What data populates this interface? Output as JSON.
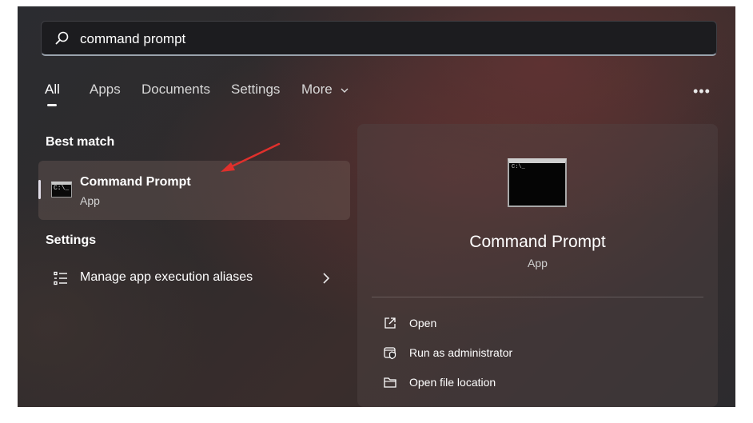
{
  "search": {
    "value": "command prompt"
  },
  "tabs": [
    {
      "label": "All",
      "active": true
    },
    {
      "label": "Apps"
    },
    {
      "label": "Documents"
    },
    {
      "label": "Settings"
    },
    {
      "label": "More"
    }
  ],
  "more_options_label": "•••",
  "best_match": {
    "heading": "Best match",
    "item": {
      "title": "Command Prompt",
      "subtitle": "App"
    }
  },
  "settings_section": {
    "heading": "Settings",
    "item": {
      "label": "Manage app execution aliases"
    }
  },
  "preview": {
    "title": "Command Prompt",
    "subtitle": "App",
    "actions": [
      {
        "label": "Open",
        "icon": "open-icon"
      },
      {
        "label": "Run as administrator",
        "icon": "admin-shield-icon"
      },
      {
        "label": "Open file location",
        "icon": "folder-icon"
      }
    ]
  },
  "colors": {
    "arrow": "#e0302c",
    "search_underline": "#9aa3ad",
    "selection_accent": "#e1dde8"
  }
}
